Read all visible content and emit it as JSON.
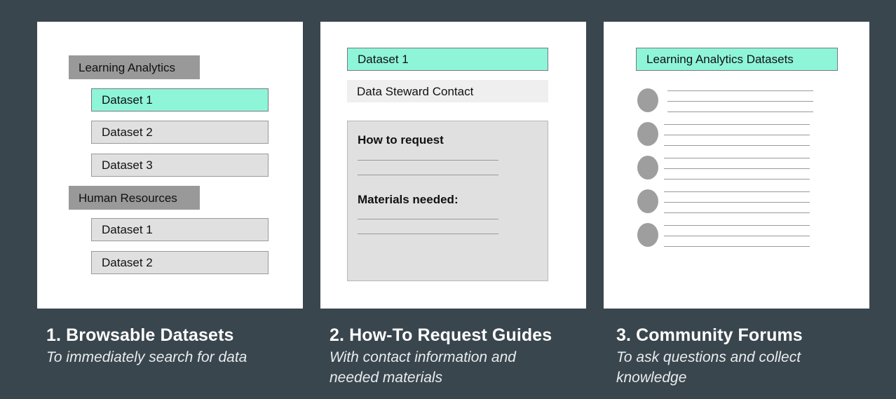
{
  "panel1": {
    "categories": [
      {
        "label": "Learning Analytics",
        "datasets": [
          {
            "label": "Dataset 1",
            "selected": true
          },
          {
            "label": "Dataset 2",
            "selected": false
          },
          {
            "label": "Dataset 3",
            "selected": false
          }
        ]
      },
      {
        "label": "Human Resources",
        "datasets": [
          {
            "label": "Dataset 1",
            "selected": false
          },
          {
            "label": "Dataset 2",
            "selected": false
          }
        ]
      }
    ]
  },
  "panel2": {
    "dataset_title": "Dataset 1",
    "contact_label": "Data Steward Contact",
    "how_to_request": "How to request",
    "materials_needed": "Materials needed:"
  },
  "panel3": {
    "forum_title": "Learning Analytics Datasets",
    "post_count": 5
  },
  "captions": [
    {
      "title": "1. Browsable Datasets",
      "subtitle": "To immediately search for data"
    },
    {
      "title": "2. How-To Request Guides",
      "subtitle": "With contact information and needed materials"
    },
    {
      "title": "3. Community Forums",
      "subtitle": "To ask questions and collect knowledge"
    }
  ],
  "colors": {
    "background": "#3a464e",
    "panel": "#ffffff",
    "highlight_teal": "#8ef5d9",
    "category_gray": "#999999",
    "item_gray": "#e0e0e0"
  }
}
